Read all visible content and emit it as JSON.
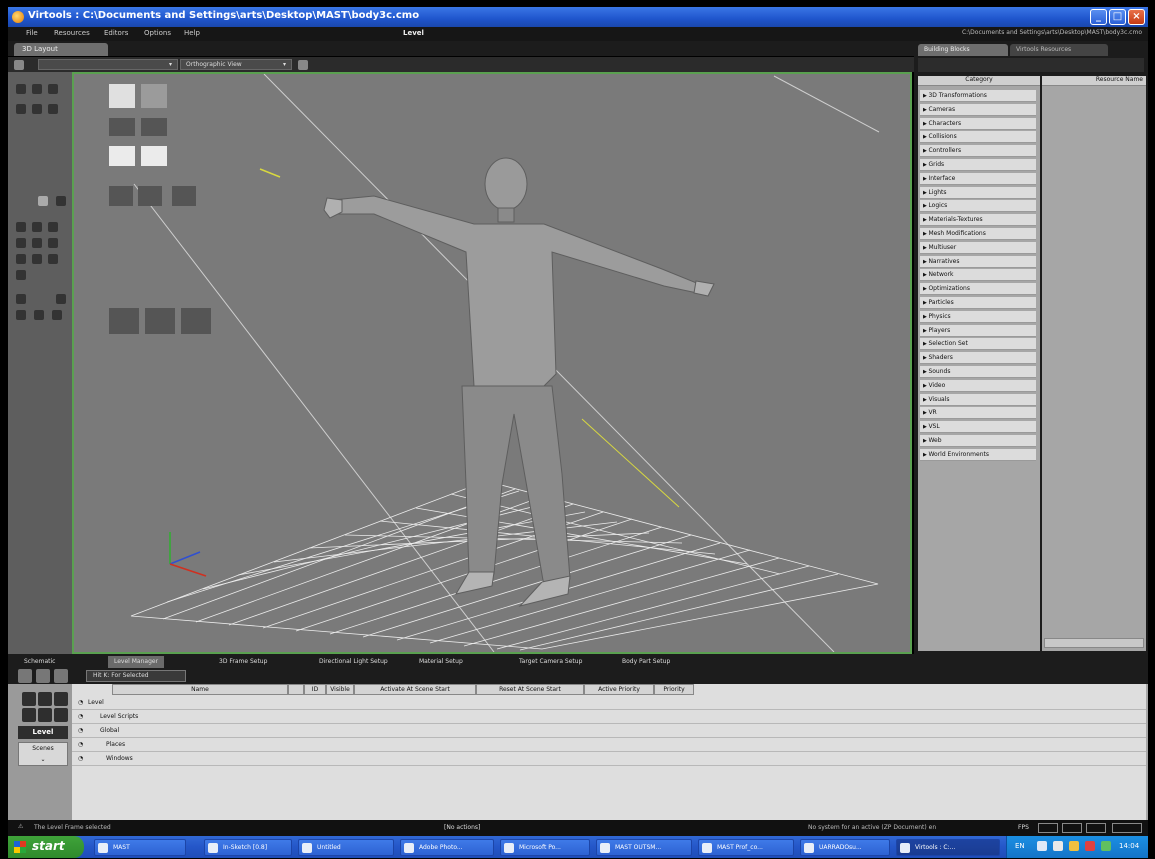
{
  "window": {
    "title": "Virtools : C:\\Documents and Settings\\arts\\Desktop\\MAST\\body3c.cmo",
    "menus": [
      "File",
      "Resources",
      "Editors",
      "Options",
      "Help"
    ],
    "center_label": "Level",
    "path_text": "C:\\Documents and Settings\\arts\\Desktop\\MAST\\body3c.cmo"
  },
  "layout": {
    "tab": "3D Layout",
    "camera_dropdown": "Orthographic View"
  },
  "right_panel": {
    "tabs": [
      "Building Blocks",
      "Virtools Resources"
    ],
    "category_header": "Category",
    "resource_header": "Resource Name",
    "categories": [
      "3D Transformations",
      "Cameras",
      "Characters",
      "Collisions",
      "Controllers",
      "Grids",
      "Interface",
      "Lights",
      "Logics",
      "Materials-Textures",
      "Mesh Modifications",
      "Multiuser",
      "Narratives",
      "Network",
      "Optimizations",
      "Particles",
      "Physics",
      "Players",
      "Selection Set",
      "Shaders",
      "Sounds",
      "Video",
      "Visuals",
      "VR",
      "VSL",
      "Web",
      "World Environments"
    ]
  },
  "bottom_tabs": [
    "Schematic",
    "Level Manager",
    "3D Frame Setup",
    "Directional Light Setup",
    "Material Setup",
    "Target Camera Setup",
    "Body Part Setup"
  ],
  "level_manager": {
    "filter_label": "Hit K: For Selected",
    "side_buttons": [
      "Level",
      "Scenes"
    ],
    "columns": [
      "Name",
      "ID",
      "Visible",
      "Activate At Scene Start",
      "Reset At Scene Start",
      "Active Priority",
      "Priority"
    ],
    "rows": [
      "Level",
      "Level Scripts",
      "Global",
      "Places",
      "Windows"
    ]
  },
  "status": {
    "left": "The Level Frame selected",
    "center": "[No actions]",
    "right": "No system for an active (ZP Document) en",
    "fps_label": "FPS"
  },
  "taskbar": {
    "start": "start",
    "tasks": [
      "MAST",
      "In-Sketch [0.8]",
      "Untitled",
      "Adobe Photo...",
      "Microsoft Po...",
      "MAST OUTSM...",
      "MAST Prof_co...",
      "UARRADOsu...",
      "Virtools : C:..."
    ],
    "clock": "14:04",
    "language": "EN"
  },
  "colors": {
    "viewport_border": "#5aa050",
    "axis_x": "#d03020",
    "axis_y": "#30b030",
    "axis_z": "#3050d0",
    "light_line": "#d8d840"
  }
}
